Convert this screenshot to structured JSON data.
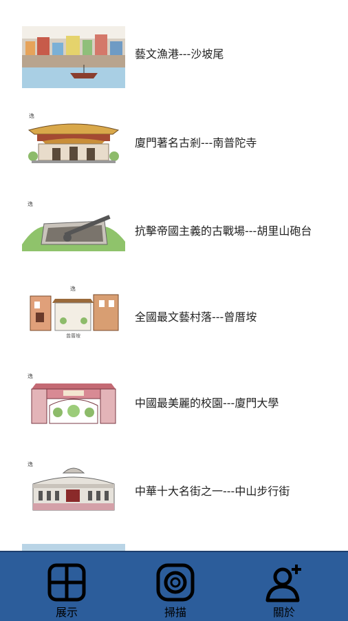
{
  "list": {
    "items": [
      {
        "title": "藝文漁港---沙坡尾",
        "thumb_icon": "harbor-illustration"
      },
      {
        "title": "廈門著名古剎---南普陀寺",
        "thumb_icon": "temple-illustration"
      },
      {
        "title": "抗擊帝國主義的古戰場---胡里山砲台",
        "thumb_icon": "cannon-fort-illustration"
      },
      {
        "title": "全國最文藝村落---曾厝垵",
        "thumb_icon": "village-gate-illustration"
      },
      {
        "title": "中國最美麗的校園---廈門大學",
        "thumb_icon": "university-gate-illustration"
      },
      {
        "title": "中華十大名街之一---中山步行街",
        "thumb_icon": "street-building-illustration"
      }
    ]
  },
  "tabbar": {
    "tabs": [
      {
        "label": "展示",
        "icon": "grid-icon"
      },
      {
        "label": "掃描",
        "icon": "camera-scan-icon"
      },
      {
        "label": "關於",
        "icon": "user-add-icon"
      }
    ]
  },
  "colors": {
    "tabbar_bg": "#2c5d9b",
    "text": "#222222"
  }
}
